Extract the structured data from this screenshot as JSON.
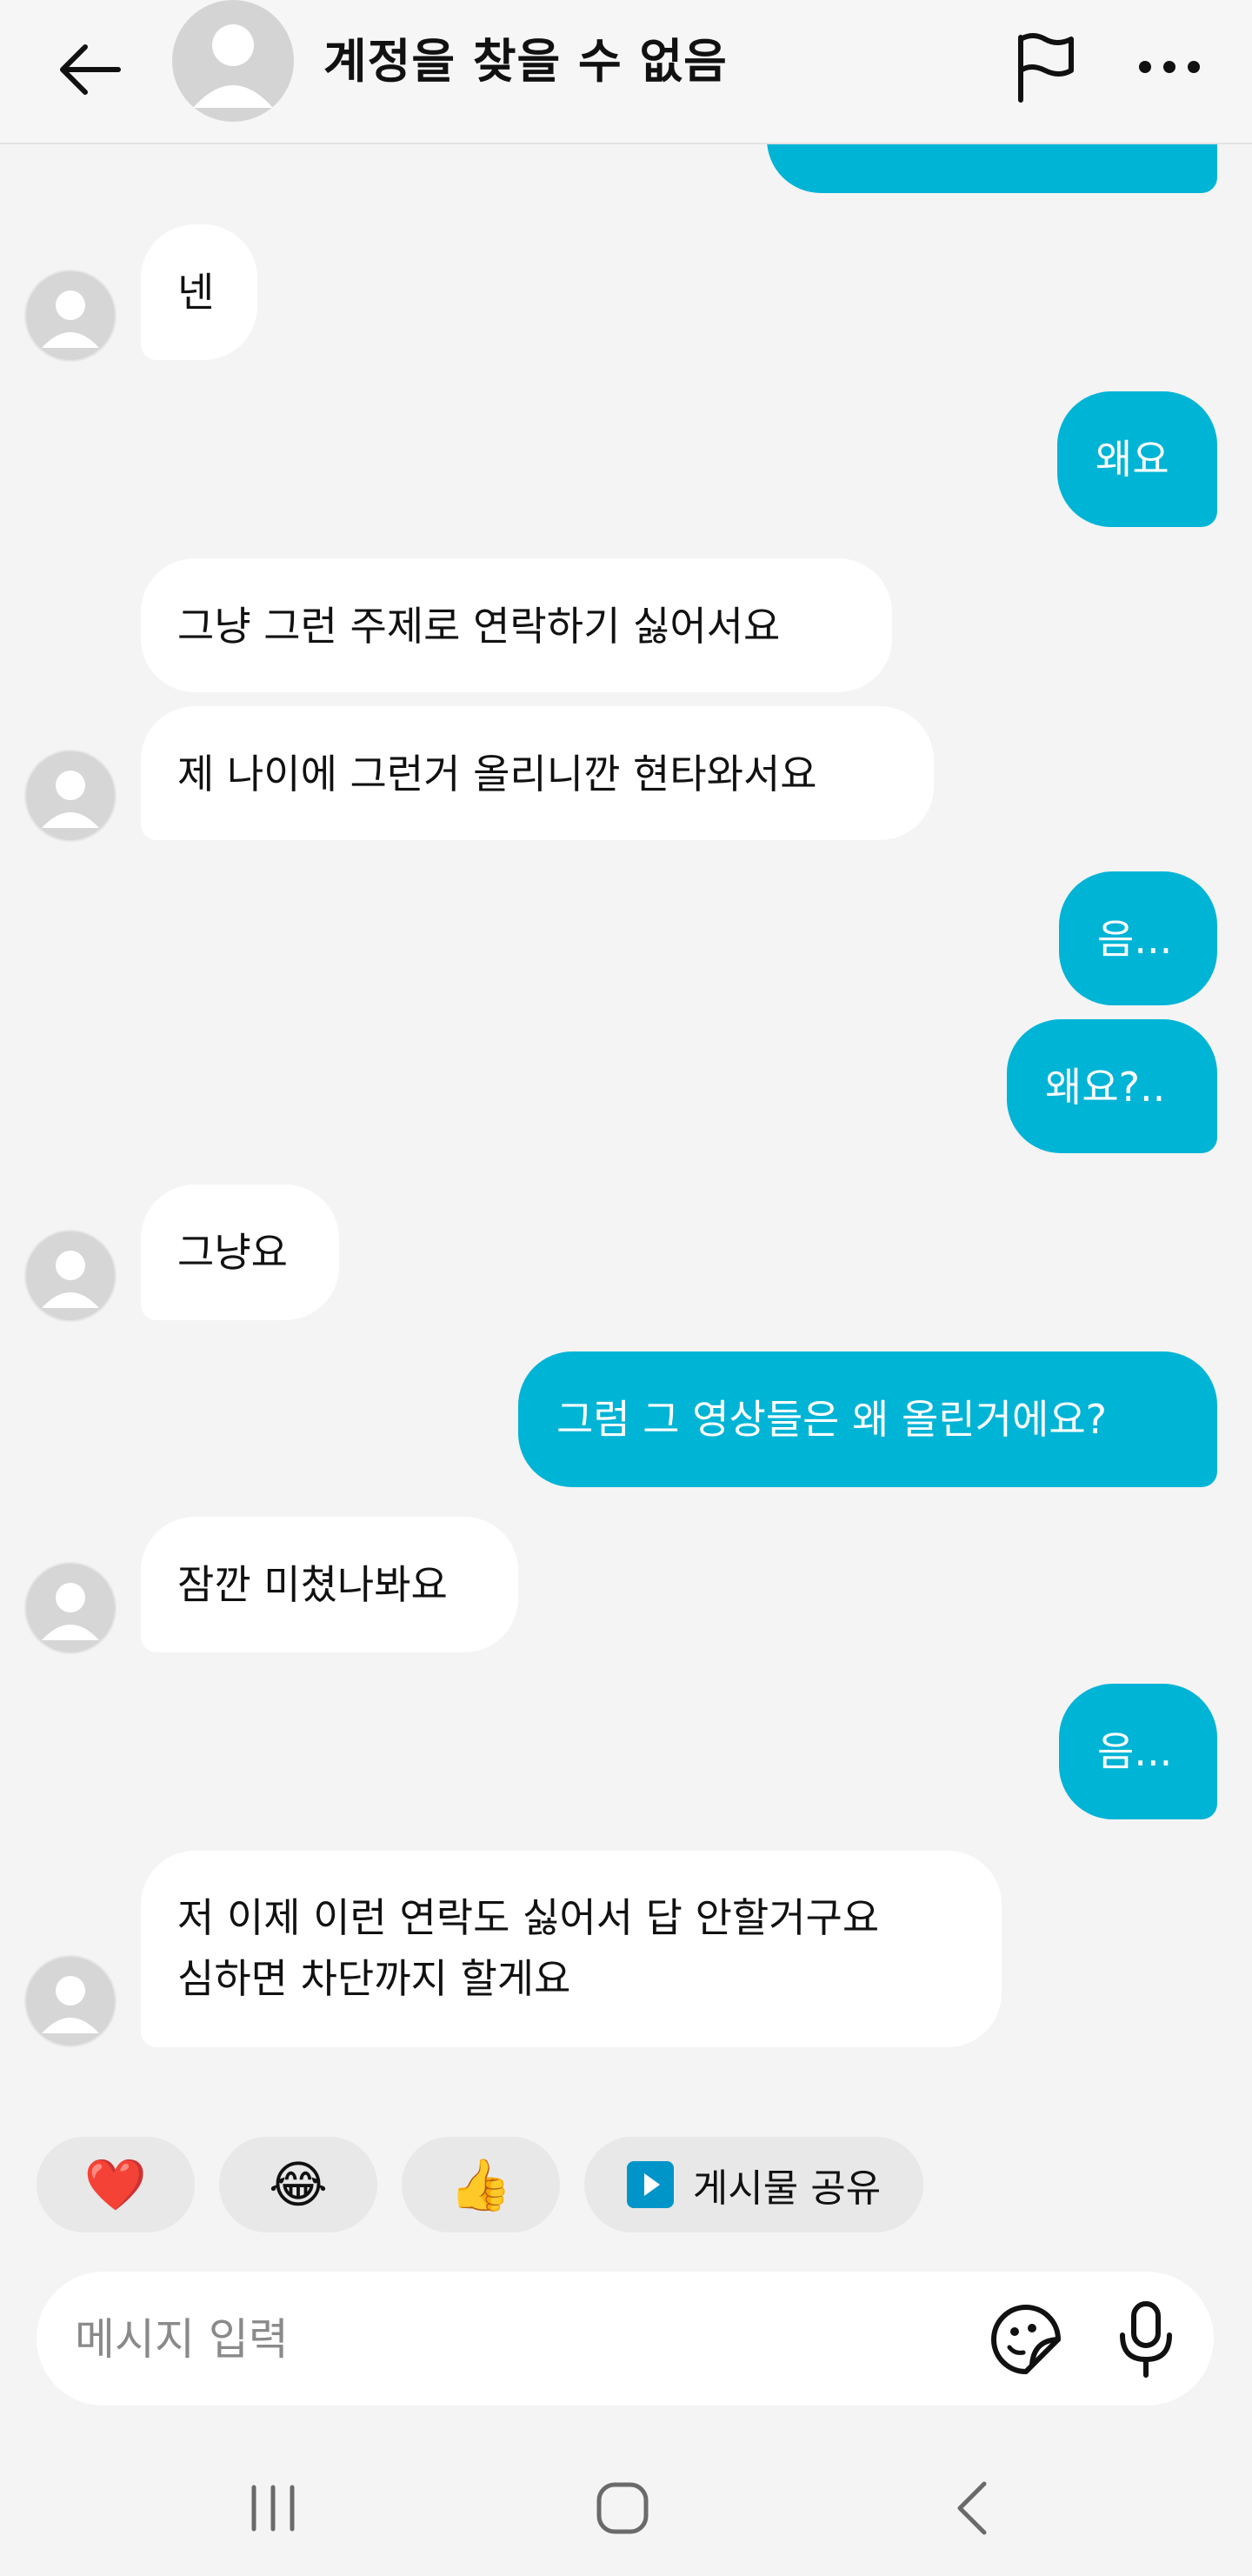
{
  "header": {
    "title": "계정을 찾을 수 없음",
    "icons": {
      "back": "arrow-left-icon",
      "avatar": "default-avatar-icon",
      "report": "flag-icon",
      "more": "more-horizontal-icon"
    }
  },
  "messages": [
    {
      "sender": "me",
      "text": ""
    },
    {
      "sender": "them",
      "text": "넨"
    },
    {
      "sender": "me",
      "text": "왜요"
    },
    {
      "sender": "them",
      "text": "그냥 그런 주제로 연락하기 싫어서요"
    },
    {
      "sender": "them",
      "text": "제 나이에 그런거 올리니깐 현타와서요"
    },
    {
      "sender": "me",
      "text": "음..."
    },
    {
      "sender": "me",
      "text": "왜요?.."
    },
    {
      "sender": "them",
      "text": "그냥요"
    },
    {
      "sender": "me",
      "text": "그럼 그 영상들은 왜 올린거에요?"
    },
    {
      "sender": "them",
      "text": "잠깐 미쳤나봐요"
    },
    {
      "sender": "me",
      "text": "음..."
    },
    {
      "sender": "them",
      "lines": [
        "저 이제 이런 연락도 싫어서 답 안할거구요",
        "심하면 차단까지 할게요"
      ]
    }
  ],
  "quick_reactions": [
    {
      "emoji": "❤️",
      "icon": "heart-icon"
    },
    {
      "emoji": "😂",
      "icon": "tears-of-joy-icon"
    },
    {
      "emoji": "👍",
      "icon": "thumbs-up-icon"
    },
    {
      "label": "게시물 공유",
      "icon": "share-post-icon"
    }
  ],
  "composer": {
    "placeholder": "메시지 입력",
    "value": "",
    "icons": {
      "sticker": "sticker-icon",
      "mic": "microphone-icon"
    }
  },
  "system_nav": {
    "icons": [
      "recents-icon",
      "home-icon",
      "back-icon"
    ]
  },
  "colors": {
    "outgoing_bubble": "#00b4d6",
    "incoming_bubble": "#ffffff",
    "background": "#f4f4f4",
    "chip_background": "#e8e8e8",
    "share_icon": "#0095c8"
  }
}
